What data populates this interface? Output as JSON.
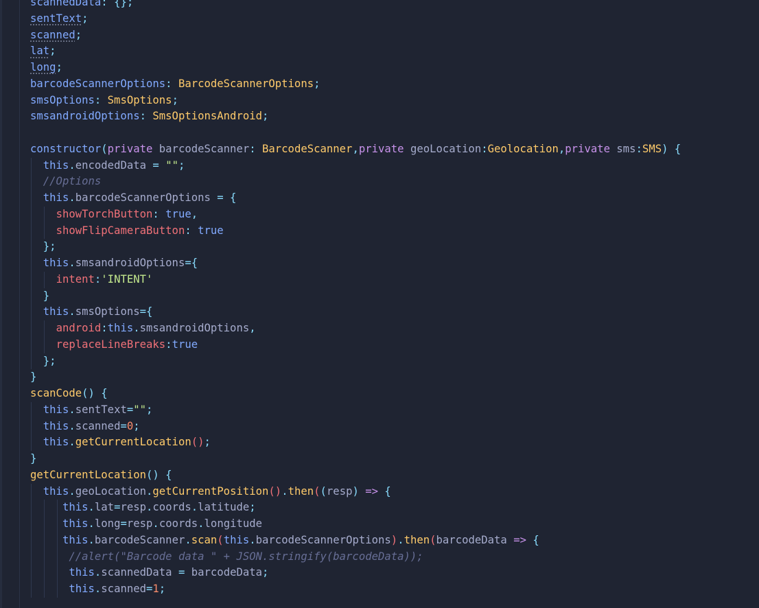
{
  "editor": {
    "language": "typescript",
    "lines": [
      [
        {
          "t": "m",
          "v": "scannedData"
        },
        {
          "t": "p",
          "v": ": "
        },
        {
          "t": "p",
          "v": "{};"
        }
      ],
      [
        {
          "t": "m dot",
          "v": "sentText"
        },
        {
          "t": "p",
          "v": ";"
        }
      ],
      [
        {
          "t": "m dot",
          "v": "scanned"
        },
        {
          "t": "p",
          "v": ";"
        }
      ],
      [
        {
          "t": "m dot",
          "v": "lat"
        },
        {
          "t": "p",
          "v": ";"
        }
      ],
      [
        {
          "t": "m dot",
          "v": "long"
        },
        {
          "t": "p",
          "v": ";"
        }
      ],
      [
        {
          "t": "m",
          "v": "barcodeScannerOptions"
        },
        {
          "t": "p",
          "v": ": "
        },
        {
          "t": "ty",
          "v": "BarcodeScannerOptions"
        },
        {
          "t": "p",
          "v": ";"
        }
      ],
      [
        {
          "t": "m",
          "v": "smsOptions"
        },
        {
          "t": "p",
          "v": ": "
        },
        {
          "t": "ty",
          "v": "SmsOptions"
        },
        {
          "t": "p",
          "v": ";"
        }
      ],
      [
        {
          "t": "m",
          "v": "smsandroidOptions"
        },
        {
          "t": "p",
          "v": ": "
        },
        {
          "t": "ty",
          "v": "SmsOptionsAndroid"
        },
        {
          "t": "p",
          "v": ";"
        }
      ],
      [],
      [
        {
          "t": "f",
          "v": "constructor"
        },
        {
          "t": "p",
          "v": "("
        },
        {
          "t": "k",
          "v": "private "
        },
        {
          "t": "id",
          "v": "barcodeScanner"
        },
        {
          "t": "p",
          "v": ": "
        },
        {
          "t": "ty",
          "v": "BarcodeScanner"
        },
        {
          "t": "p",
          "v": ","
        },
        {
          "t": "k",
          "v": "private "
        },
        {
          "t": "id",
          "v": "geoLocation"
        },
        {
          "t": "p",
          "v": ":"
        },
        {
          "t": "ty",
          "v": "Geolocation"
        },
        {
          "t": "p",
          "v": ","
        },
        {
          "t": "k",
          "v": "private "
        },
        {
          "t": "id",
          "v": "sms"
        },
        {
          "t": "p",
          "v": ":"
        },
        {
          "t": "ty",
          "v": "SMS"
        },
        {
          "t": "p",
          "v": ") {"
        }
      ],
      [
        {
          "t": "id",
          "v": "  "
        },
        {
          "t": "t",
          "v": "this"
        },
        {
          "t": "p",
          "v": "."
        },
        {
          "t": "id",
          "v": "encodedData"
        },
        {
          "t": "p",
          "v": " = "
        },
        {
          "t": "s",
          "v": "\"\""
        },
        {
          "t": "p",
          "v": ";"
        }
      ],
      [
        {
          "t": "id",
          "v": "  "
        },
        {
          "t": "c",
          "v": "//Options"
        }
      ],
      [
        {
          "t": "id",
          "v": "  "
        },
        {
          "t": "t",
          "v": "this"
        },
        {
          "t": "p",
          "v": "."
        },
        {
          "t": "id",
          "v": "barcodeScannerOptions"
        },
        {
          "t": "p",
          "v": " = {"
        }
      ],
      [
        {
          "t": "id",
          "v": "    "
        },
        {
          "t": "pr",
          "v": "showTorchButton"
        },
        {
          "t": "p",
          "v": ": "
        },
        {
          "t": "b",
          "v": "true"
        },
        {
          "t": "p",
          "v": ","
        }
      ],
      [
        {
          "t": "id",
          "v": "    "
        },
        {
          "t": "pr",
          "v": "showFlipCameraButton"
        },
        {
          "t": "p",
          "v": ": "
        },
        {
          "t": "b",
          "v": "true"
        }
      ],
      [
        {
          "t": "id",
          "v": "  "
        },
        {
          "t": "p",
          "v": "};"
        }
      ],
      [
        {
          "t": "id",
          "v": "  "
        },
        {
          "t": "t",
          "v": "this"
        },
        {
          "t": "p",
          "v": "."
        },
        {
          "t": "id",
          "v": "smsandroidOptions"
        },
        {
          "t": "p",
          "v": "={"
        }
      ],
      [
        {
          "t": "id",
          "v": "    "
        },
        {
          "t": "pr",
          "v": "intent"
        },
        {
          "t": "p",
          "v": ":"
        },
        {
          "t": "s",
          "v": "'INTENT'"
        }
      ],
      [
        {
          "t": "id",
          "v": "  "
        },
        {
          "t": "p",
          "v": "}"
        }
      ],
      [
        {
          "t": "id",
          "v": "  "
        },
        {
          "t": "t",
          "v": "this"
        },
        {
          "t": "p",
          "v": "."
        },
        {
          "t": "id",
          "v": "smsOptions"
        },
        {
          "t": "p",
          "v": "={"
        }
      ],
      [
        {
          "t": "id",
          "v": "    "
        },
        {
          "t": "pr",
          "v": "android"
        },
        {
          "t": "p",
          "v": ":"
        },
        {
          "t": "t",
          "v": "this"
        },
        {
          "t": "p",
          "v": "."
        },
        {
          "t": "id",
          "v": "smsandroidOptions"
        },
        {
          "t": "p",
          "v": ","
        }
      ],
      [
        {
          "t": "id",
          "v": "    "
        },
        {
          "t": "pr",
          "v": "replaceLineBreaks"
        },
        {
          "t": "p",
          "v": ":"
        },
        {
          "t": "b",
          "v": "true"
        }
      ],
      [
        {
          "t": "id",
          "v": "  "
        },
        {
          "t": "p",
          "v": "};"
        }
      ],
      [
        {
          "t": "p",
          "v": "}"
        }
      ],
      [
        {
          "t": "fn",
          "v": "scanCode"
        },
        {
          "t": "p",
          "v": "() {"
        }
      ],
      [
        {
          "t": "id",
          "v": "  "
        },
        {
          "t": "t",
          "v": "this"
        },
        {
          "t": "p",
          "v": "."
        },
        {
          "t": "id",
          "v": "sentText"
        },
        {
          "t": "p",
          "v": "="
        },
        {
          "t": "s",
          "v": "\"\""
        },
        {
          "t": "p",
          "v": ";"
        }
      ],
      [
        {
          "t": "id",
          "v": "  "
        },
        {
          "t": "t",
          "v": "this"
        },
        {
          "t": "p",
          "v": "."
        },
        {
          "t": "id",
          "v": "scanned"
        },
        {
          "t": "p",
          "v": "="
        },
        {
          "t": "n",
          "v": "0"
        },
        {
          "t": "p",
          "v": ";"
        }
      ],
      [
        {
          "t": "id",
          "v": "  "
        },
        {
          "t": "t",
          "v": "this"
        },
        {
          "t": "p",
          "v": "."
        },
        {
          "t": "fn",
          "v": "getCurrentLocation"
        },
        {
          "t": "pr",
          "v": "()"
        },
        {
          "t": "p",
          "v": ";"
        }
      ],
      [
        {
          "t": "p",
          "v": "}"
        }
      ],
      [
        {
          "t": "fn",
          "v": "getCurrentLocation"
        },
        {
          "t": "p",
          "v": "() {"
        }
      ],
      [
        {
          "t": "id",
          "v": "  "
        },
        {
          "t": "t",
          "v": "this"
        },
        {
          "t": "p",
          "v": "."
        },
        {
          "t": "id",
          "v": "geoLocation"
        },
        {
          "t": "p",
          "v": "."
        },
        {
          "t": "fn",
          "v": "getCurrentPosition"
        },
        {
          "t": "pr",
          "v": "()"
        },
        {
          "t": "p",
          "v": "."
        },
        {
          "t": "fn",
          "v": "then"
        },
        {
          "t": "pr",
          "v": "("
        },
        {
          "t": "p",
          "v": "("
        },
        {
          "t": "id",
          "v": "resp"
        },
        {
          "t": "p",
          "v": ") "
        },
        {
          "t": "k",
          "v": "=>"
        },
        {
          "t": "p",
          "v": " {"
        }
      ],
      [
        {
          "t": "id",
          "v": "     "
        },
        {
          "t": "t",
          "v": "this"
        },
        {
          "t": "p",
          "v": "."
        },
        {
          "t": "id",
          "v": "lat"
        },
        {
          "t": "p",
          "v": "="
        },
        {
          "t": "id",
          "v": "resp"
        },
        {
          "t": "p",
          "v": "."
        },
        {
          "t": "id",
          "v": "coords"
        },
        {
          "t": "p",
          "v": "."
        },
        {
          "t": "id",
          "v": "latitude"
        },
        {
          "t": "p",
          "v": ";"
        }
      ],
      [
        {
          "t": "id",
          "v": "     "
        },
        {
          "t": "t",
          "v": "this"
        },
        {
          "t": "p",
          "v": "."
        },
        {
          "t": "id",
          "v": "long"
        },
        {
          "t": "p",
          "v": "="
        },
        {
          "t": "id",
          "v": "resp"
        },
        {
          "t": "p",
          "v": "."
        },
        {
          "t": "id",
          "v": "coords"
        },
        {
          "t": "p",
          "v": "."
        },
        {
          "t": "id",
          "v": "longitude"
        }
      ],
      [
        {
          "t": "id",
          "v": "     "
        },
        {
          "t": "t",
          "v": "this"
        },
        {
          "t": "p",
          "v": "."
        },
        {
          "t": "id",
          "v": "barcodeScanner"
        },
        {
          "t": "p",
          "v": "."
        },
        {
          "t": "fn",
          "v": "scan"
        },
        {
          "t": "pr",
          "v": "("
        },
        {
          "t": "t",
          "v": "this"
        },
        {
          "t": "p",
          "v": "."
        },
        {
          "t": "id",
          "v": "barcodeScannerOptions"
        },
        {
          "t": "pr",
          "v": ")"
        },
        {
          "t": "p",
          "v": "."
        },
        {
          "t": "fn",
          "v": "then"
        },
        {
          "t": "pr",
          "v": "("
        },
        {
          "t": "id",
          "v": "barcodeData"
        },
        {
          "t": "k",
          "v": " => "
        },
        {
          "t": "p",
          "v": "{"
        }
      ],
      [
        {
          "t": "id",
          "v": "      "
        },
        {
          "t": "c",
          "v": "//alert(\"Barcode data \" + JSON.stringify(barcodeData));"
        }
      ],
      [
        {
          "t": "id",
          "v": "      "
        },
        {
          "t": "t",
          "v": "this"
        },
        {
          "t": "p",
          "v": "."
        },
        {
          "t": "id",
          "v": "scannedData"
        },
        {
          "t": "p",
          "v": " = "
        },
        {
          "t": "id",
          "v": "barcodeData"
        },
        {
          "t": "p",
          "v": ";"
        }
      ],
      [
        {
          "t": "id",
          "v": "      "
        },
        {
          "t": "t",
          "v": "this"
        },
        {
          "t": "p",
          "v": "."
        },
        {
          "t": "id",
          "v": "scanned"
        },
        {
          "t": "p",
          "v": "="
        },
        {
          "t": "n",
          "v": "1"
        },
        {
          "t": "p",
          "v": ";"
        }
      ]
    ]
  }
}
